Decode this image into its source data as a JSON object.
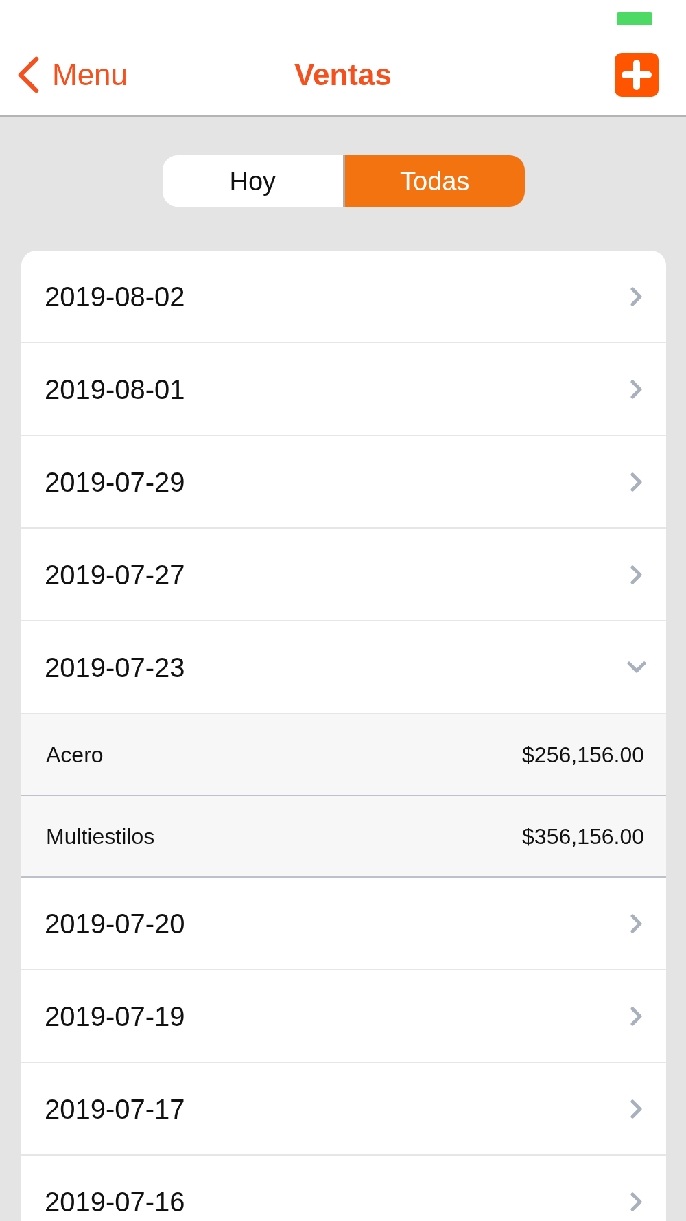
{
  "nav_bar": {
    "back_label": "Menu",
    "title": "Ventas"
  },
  "segmented_control": [
    {
      "label": "Hoy",
      "selected": false
    },
    {
      "label": "Todas",
      "selected": true
    }
  ],
  "sales_days": [
    {
      "date": "2019-08-02",
      "expanded": false
    },
    {
      "date": "2019-08-01",
      "expanded": false
    },
    {
      "date": "2019-07-29",
      "expanded": false
    },
    {
      "date": "2019-07-27",
      "expanded": false
    },
    {
      "date": "2019-07-23",
      "expanded": true,
      "children": [
        {
          "name": "Acero",
          "amount": "$256,156.00"
        },
        {
          "name": "Multiestilos",
          "amount": "$356,156.00"
        }
      ]
    },
    {
      "date": "2019-07-20",
      "expanded": false
    },
    {
      "date": "2019-07-19",
      "expanded": false
    },
    {
      "date": "2019-07-17",
      "expanded": false
    },
    {
      "date": "2019-07-16",
      "expanded": false
    }
  ]
}
